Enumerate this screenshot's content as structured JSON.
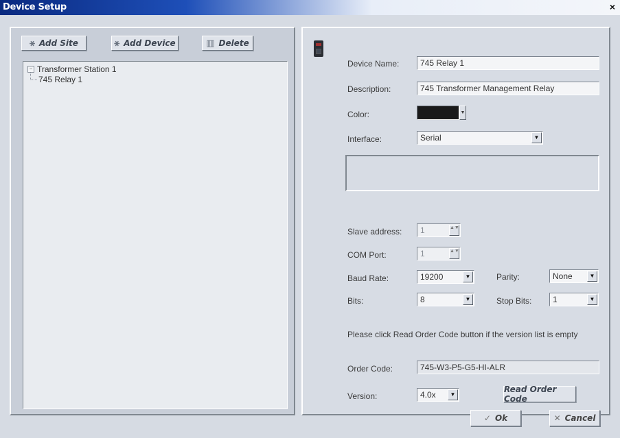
{
  "window": {
    "title": "Device Setup",
    "close_glyph": "×"
  },
  "left": {
    "toolbar": {
      "add_site_label": "Add Site",
      "add_device_label": "Add Device",
      "delete_label": "Delete"
    },
    "tree": {
      "site": "Transformer Station 1",
      "device": "745 Relay 1",
      "expand_glyph": "−"
    }
  },
  "right": {
    "device_name_label": "Device Name:",
    "device_name_value": "745 Relay 1",
    "description_label": "Description:",
    "description_value": "745 Transformer Management Relay",
    "color_label": "Color:",
    "color_value": "#1a1a1a",
    "interface_label": "Interface:",
    "interface_value": "Serial",
    "slave_address_label": "Slave address:",
    "slave_address_value": "1",
    "com_port_label": "COM Port:",
    "com_port_value": "1",
    "baud_rate_label": "Baud Rate:",
    "baud_rate_value": "19200",
    "parity_label": "Parity:",
    "parity_value": "None",
    "bits_label": "Bits:",
    "bits_value": "8",
    "stop_bits_label": "Stop Bits:",
    "stop_bits_value": "1",
    "hint_text": "Please click Read Order Code button if the version list is empty",
    "order_code_label": "Order Code:",
    "order_code_value": "745-W3-P5-G5-HI-ALR",
    "version_label": "Version:",
    "version_value": "4.0x",
    "read_order_code_label": "Read Order Code"
  },
  "footer": {
    "ok_label": "Ok",
    "cancel_label": "Cancel"
  },
  "glyphs": {
    "dropdown": "▼",
    "stepper": "▲▼"
  },
  "icons": [
    "add-site",
    "add-device",
    "delete",
    "relay-device",
    "ok",
    "cancel",
    "dropdown",
    "stepper",
    "expand"
  ],
  "colors": {
    "title_bar": "#0a2a80",
    "panel": "#d7dce4"
  }
}
